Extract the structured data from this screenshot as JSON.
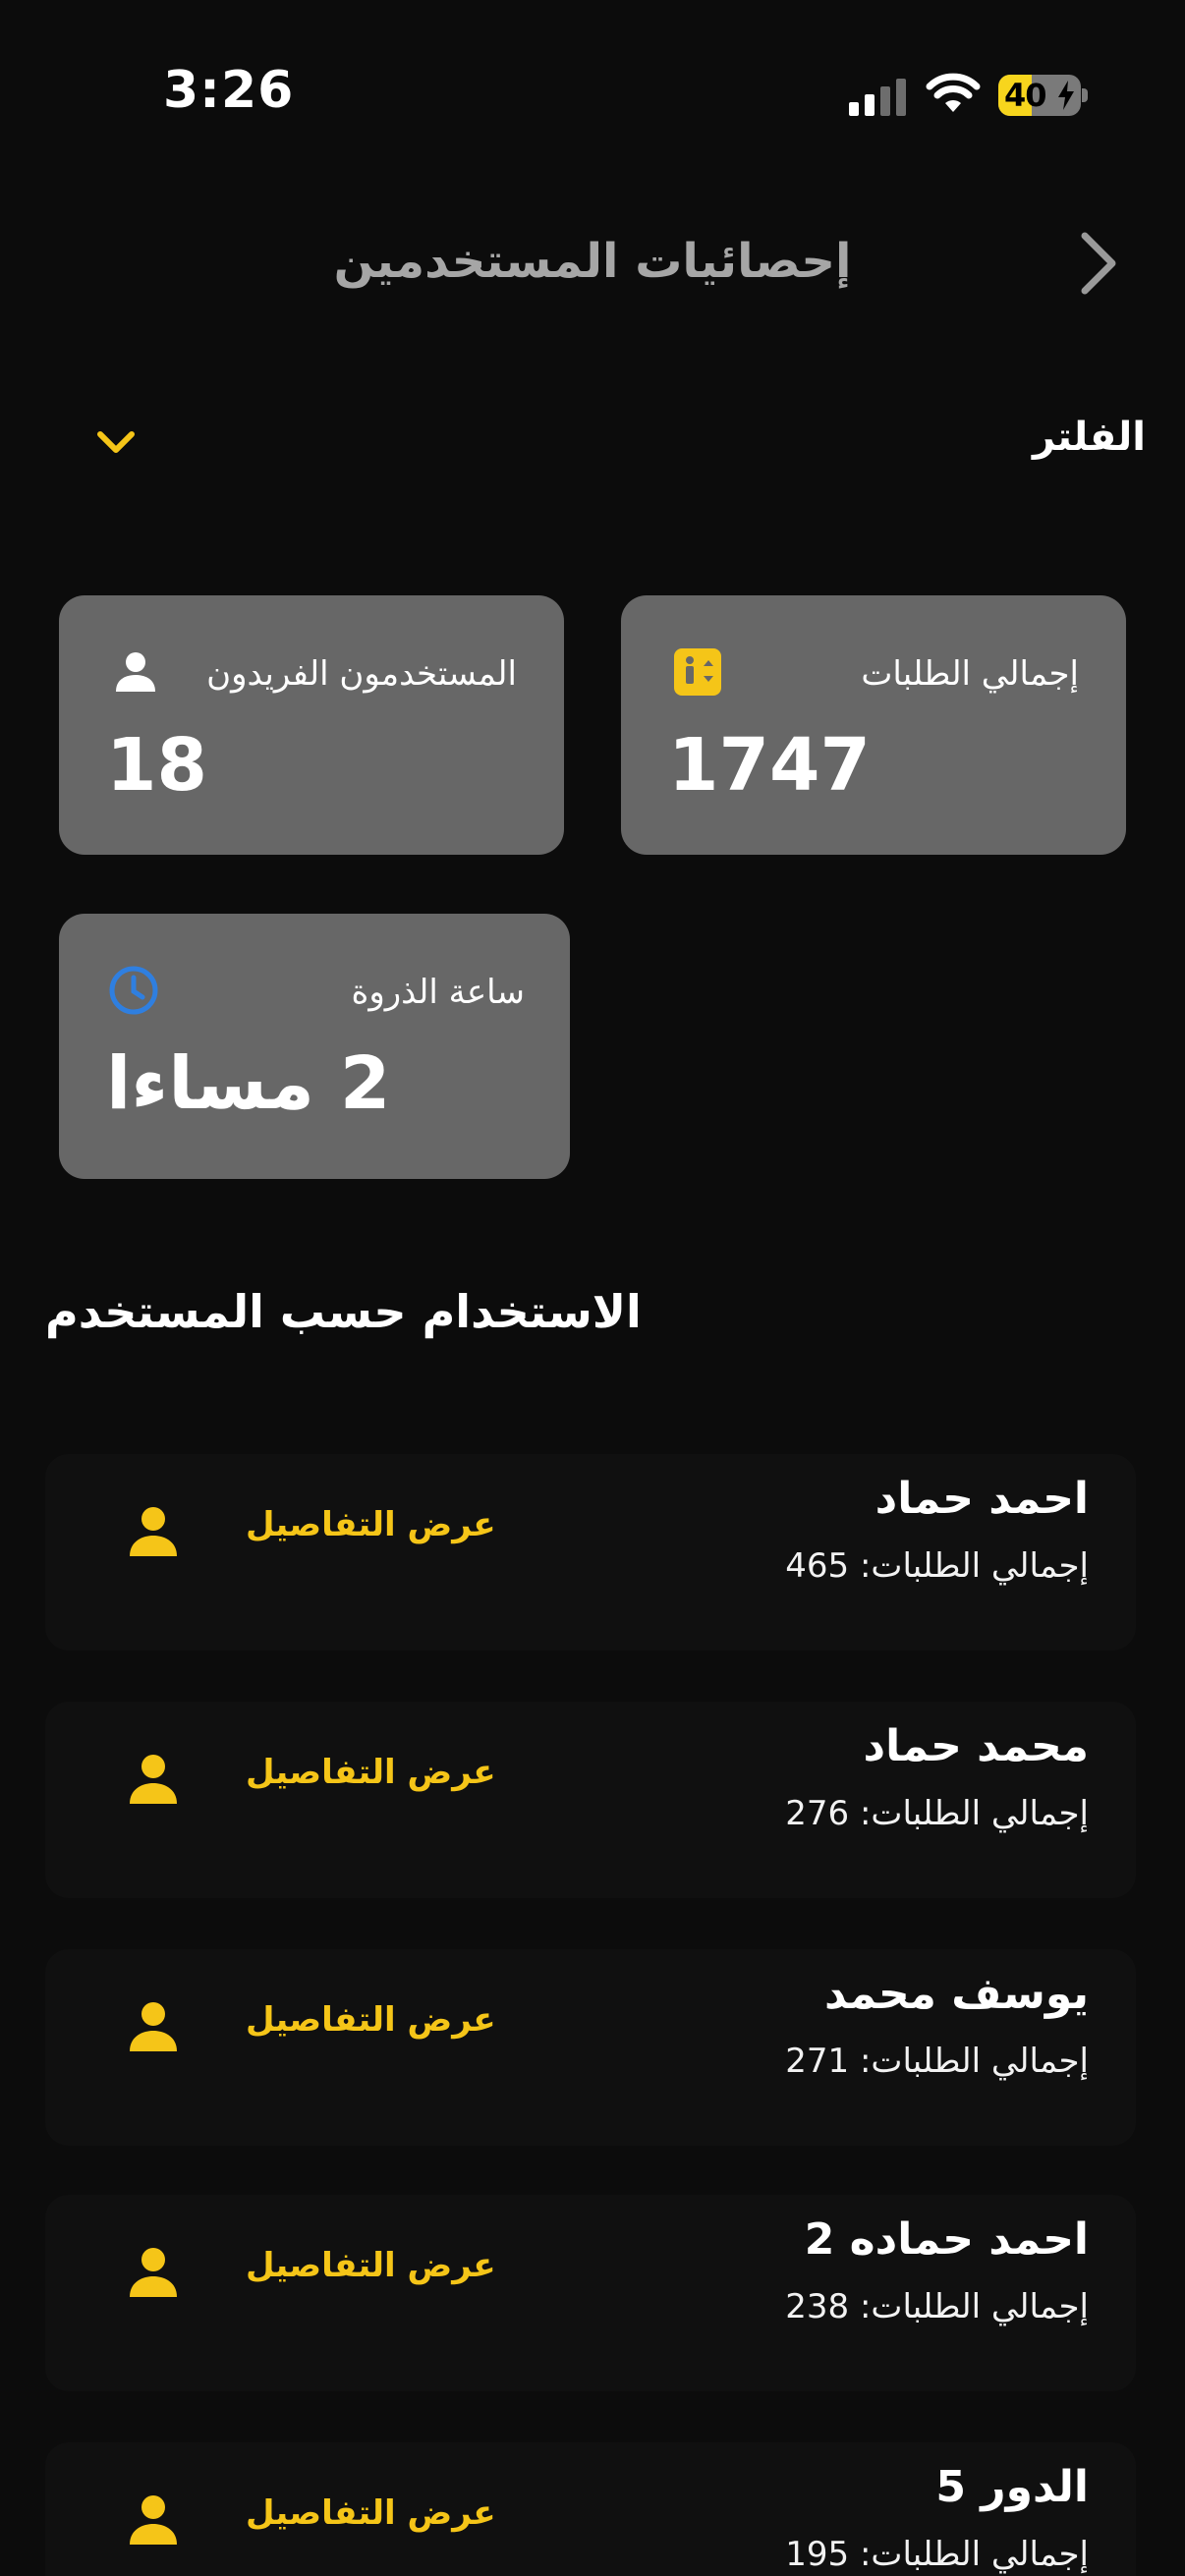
{
  "status_bar": {
    "time": "3:26",
    "battery": "40",
    "battery_level": 0.4
  },
  "header": {
    "title": "إحصائيات المستخدمين",
    "back_icon": "chevron-right-icon"
  },
  "filter": {
    "label": "الفلتر",
    "icon": "chevron-down-icon"
  },
  "stats": {
    "total_requests": {
      "label": "إجمالي الطلبات",
      "value": "1747",
      "icon": "elevator-icon"
    },
    "unique_users": {
      "label": "المستخدمون الفريدون",
      "value": "18",
      "icon": "person-icon"
    },
    "peak_hour": {
      "label": "ساعة الذروة",
      "value": "2 مساءا",
      "icon": "clock-icon"
    }
  },
  "colors": {
    "accent": "#f5c518",
    "card": "#676767",
    "background": "#0c0c0c",
    "clock": "#2f7fe0"
  },
  "usage": {
    "title": "الاستخدام حسب المستخدم",
    "details_label": "عرض التفاصيل",
    "users": [
      {
        "name": "احمد حماد",
        "total": "إجمالي الطلبات: 465"
      },
      {
        "name": "محمد حماد",
        "total": "إجمالي الطلبات: 276"
      },
      {
        "name": "يوسف محمد",
        "total": "إجمالي الطلبات: 271"
      },
      {
        "name": "احمد حماده 2",
        "total": "إجمالي الطلبات: 238"
      },
      {
        "name": "الدور 5",
        "total": "إجمالي الطلبات: 195"
      }
    ]
  }
}
